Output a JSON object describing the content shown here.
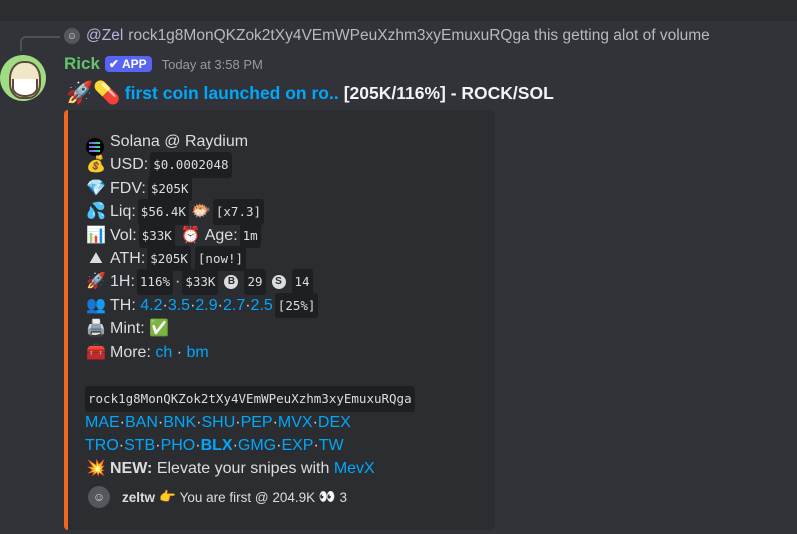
{
  "reply": {
    "mention": "@Zel",
    "text": "rock1g8MonQKZok2tXy4VEmWPeuXzhm3xyEmuxuRQga this getting alot of volume"
  },
  "message": {
    "username": "Rick",
    "badge": "APP",
    "timestamp": "Today at 3:58 PM",
    "title_emoji": "🚀💊",
    "title_link": "first coin launched on ro..",
    "title_rest": "[205K/116%] - ROCK/SOL"
  },
  "embed": {
    "accent_color": "#f26522",
    "chain": "Solana @ Raydium",
    "usd_label": "USD:",
    "usd_value": "$0.0002048",
    "fdv_label": "FDV:",
    "fdv_value": "$205K",
    "liq_label": "Liq:",
    "liq_value": "$56.4K",
    "liq_multiplier": "[x7.3]",
    "vol_label": "Vol:",
    "vol_value": "$33K",
    "age_label": "Age:",
    "age_value": "1m",
    "ath_label": "ATH:",
    "ath_value": "$205K",
    "ath_note": "[now!]",
    "h1_label": "1H:",
    "h1_pct": "116%",
    "h1_sep": "·",
    "h1_vol": "$33K",
    "h1_buys": "29",
    "h1_sells": "14",
    "th_label": "TH:",
    "th_values": [
      "4.2",
      "3.5",
      "2.9",
      "2.7",
      "2.5"
    ],
    "th_total": "[25%]",
    "mint_label": "Mint:",
    "more_label": "More:",
    "more_links": [
      "ch",
      "bm"
    ],
    "contract": "rock1g8MonQKZok2tXy4VEmWPeuXzhm3xyEmuxuRQga",
    "bots_row1": [
      "MAE",
      "BAN",
      "BNK",
      "SHU",
      "PEP",
      "MVX",
      "DEX"
    ],
    "bots_row2": [
      "TRO",
      "STB",
      "PHO",
      "BLX",
      "GMG",
      "EXP",
      "TW"
    ],
    "new_label": "NEW:",
    "new_text": "Elevate your snipes with",
    "new_link": "MevX",
    "footer_name": "zeltw",
    "footer_text": "You are first @ 204.9K",
    "footer_count": "3"
  },
  "icons": {
    "money_bag": "💰",
    "diamond": "💎",
    "droplets": "💦",
    "fish": "🐡",
    "chart": "📊",
    "clock": "⏰",
    "mountain": "⛰",
    "rocket": "🚀",
    "people": "👥",
    "printer": "🖨️",
    "check": "✅",
    "cash_register": "🧰",
    "explosion": "💥",
    "point_right": "👉",
    "eyes": "👀"
  }
}
